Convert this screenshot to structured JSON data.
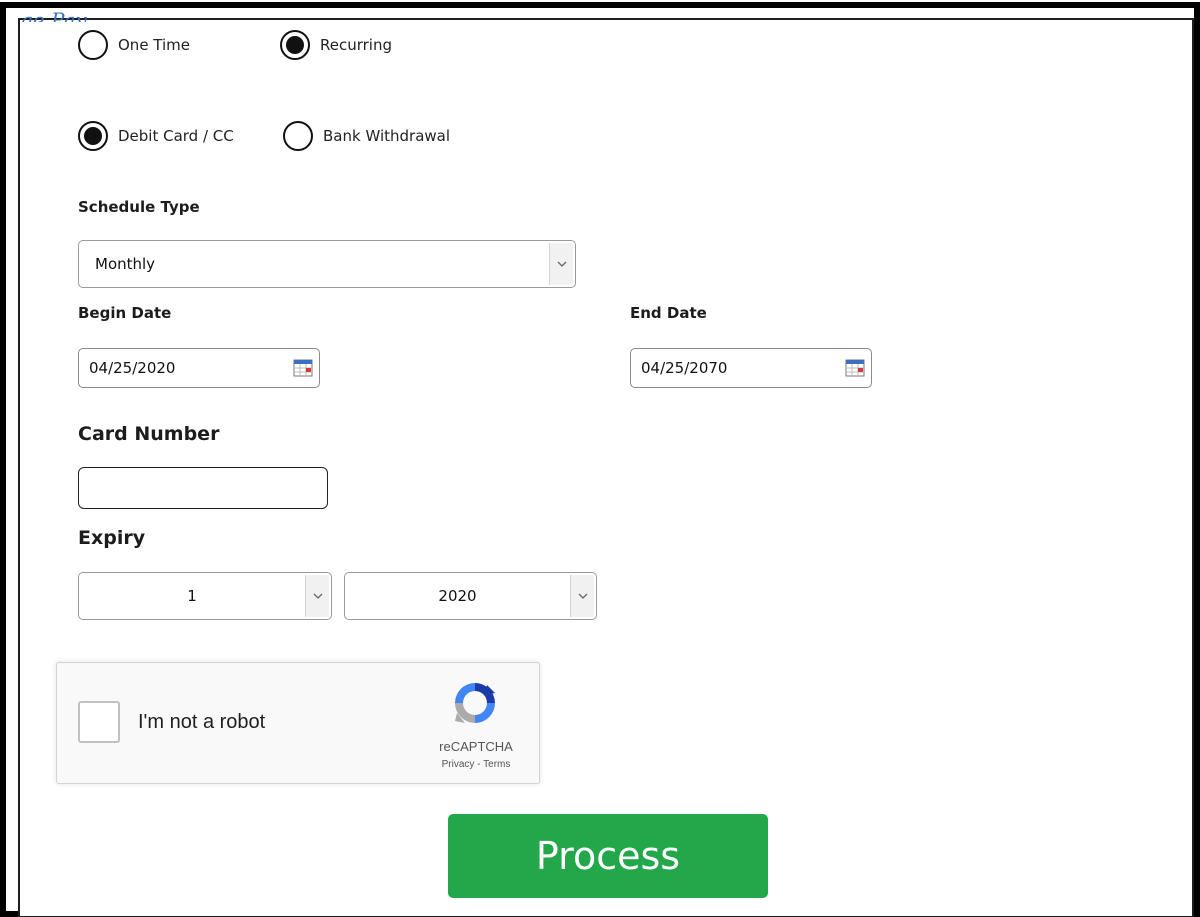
{
  "top_fragment": "ge Pay",
  "frequency": {
    "options": [
      {
        "label": "One Time",
        "selected": false
      },
      {
        "label": "Recurring",
        "selected": true
      }
    ]
  },
  "payment_method": {
    "options": [
      {
        "label": "Debit Card / CC",
        "selected": true
      },
      {
        "label": "Bank Withdrawal",
        "selected": false
      }
    ]
  },
  "schedule": {
    "label": "Schedule Type",
    "value": "Monthly"
  },
  "begin_date": {
    "label": "Begin Date",
    "value": "04/25/2020",
    "icon": "calendar-icon"
  },
  "end_date": {
    "label": "End Date",
    "value": "04/25/2070",
    "icon": "calendar-icon"
  },
  "card": {
    "label": "Card Number",
    "value": ""
  },
  "expiry": {
    "label": "Expiry",
    "month": "1",
    "year": "2020"
  },
  "captcha": {
    "label": "I'm not a robot",
    "brand": "reCAPTCHA",
    "links": "Privacy - Terms",
    "icon": "recaptcha-logo-icon"
  },
  "submit": {
    "label": "Process",
    "color": "#22a84a"
  }
}
